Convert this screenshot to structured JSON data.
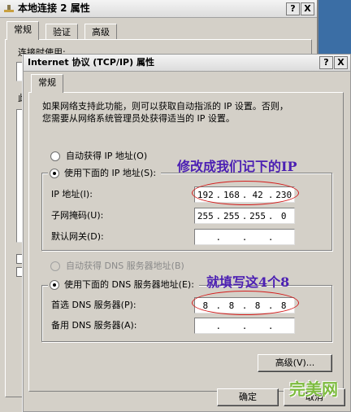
{
  "background_window": {
    "title": "本地连接 2 属性",
    "help": "?",
    "close": "X",
    "tabs": [
      "常规",
      "验证",
      "高级"
    ],
    "partial_label_1": "连接时使用:",
    "partial_label_2": "此"
  },
  "dialog": {
    "title": "Internet 协议 (TCP/IP) 属性",
    "help": "?",
    "close": "X",
    "tab": "常规",
    "description": "如果网络支持此功能，则可以获取自动指派的 IP 设置。否则，\n您需要从网络系统管理员处获得适当的 IP 设置。",
    "auto_ip": "自动获得 IP 地址(O)",
    "manual_ip": "使用下面的 IP 地址(S):",
    "ip_label": "IP 地址(I):",
    "ip_value": [
      "192",
      "168",
      "42",
      "230"
    ],
    "mask_label": "子网掩码(U):",
    "mask_value": [
      "255",
      "255",
      "255",
      "0"
    ],
    "gateway_label": "默认网关(D):",
    "gateway_value": [
      "",
      "",
      "",
      ""
    ],
    "auto_dns": "自动获得 DNS 服务器地址(B)",
    "manual_dns": "使用下面的 DNS 服务器地址(E):",
    "dns1_label": "首选 DNS 服务器(P):",
    "dns1_value": [
      "8",
      "8",
      "8",
      "8"
    ],
    "dns2_label": "备用 DNS 服务器(A):",
    "dns2_value": [
      "",
      "",
      "",
      ""
    ],
    "advanced": "高级(V)...",
    "ok": "确定",
    "cancel": "取消"
  },
  "annotations": {
    "ip_note": "修改成我们记下的IP",
    "dns_note": "就填写这4个8",
    "color": "#4b1fb3",
    "circle_color": "#d41e1e"
  },
  "watermark": "完美网"
}
